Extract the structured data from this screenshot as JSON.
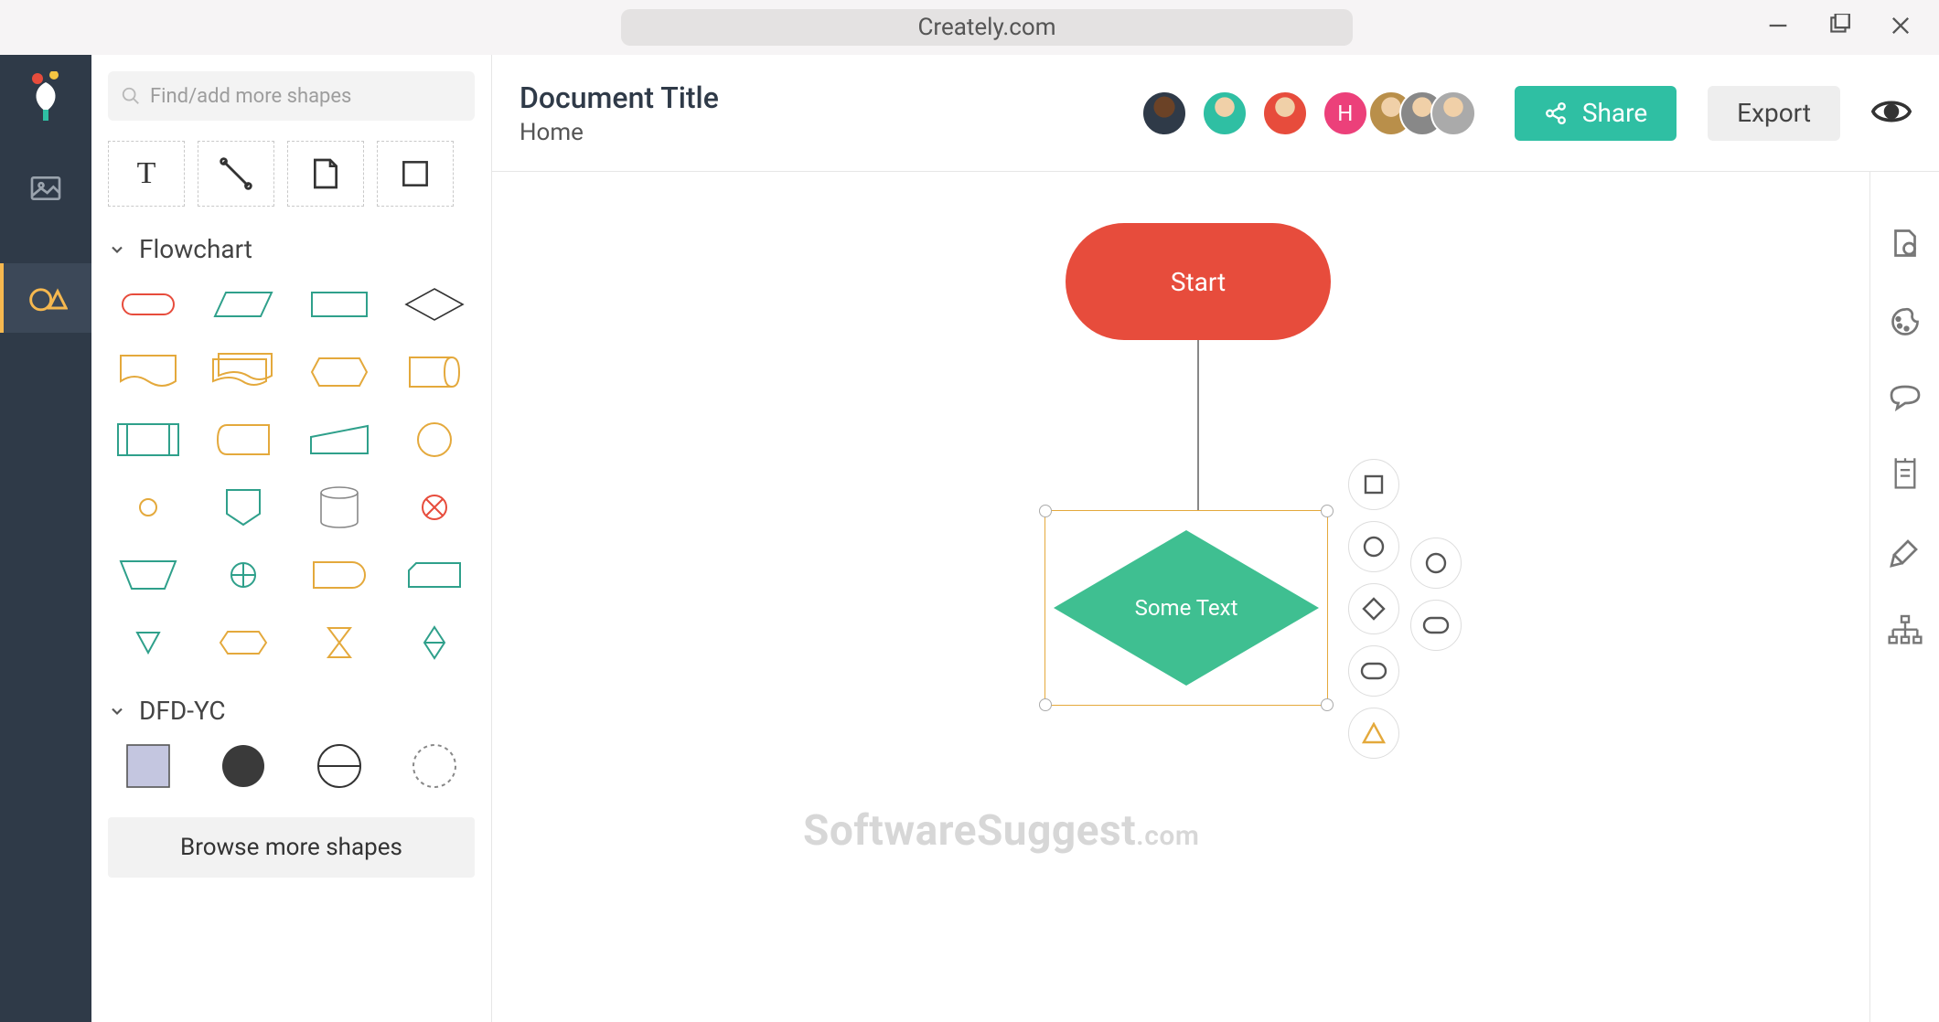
{
  "titlebar": {
    "url": "Creately.com"
  },
  "rail": {
    "items": [
      "image",
      "shapes"
    ]
  },
  "sidebar": {
    "search_placeholder": "Find/add more shapes",
    "categories": [
      {
        "name": "Flowchart"
      },
      {
        "name": "DFD-YC"
      }
    ],
    "browse_label": "Browse more shapes"
  },
  "header": {
    "title": "Document Title",
    "breadcrumb": "Home",
    "share_label": "Share",
    "export_label": "Export",
    "avatars": [
      {
        "bg": "#f5c542"
      },
      {
        "bg": "#2f3a48"
      },
      {
        "bg": "#2fbfa3"
      },
      {
        "bg": "#e74c3c"
      },
      {
        "bg": "#ec407a",
        "initial": "H"
      }
    ]
  },
  "canvas": {
    "start_label": "Start",
    "decision_label": "Some Text"
  },
  "watermark": {
    "brand": "SoftwareSuggest",
    "suffix": ".com"
  }
}
